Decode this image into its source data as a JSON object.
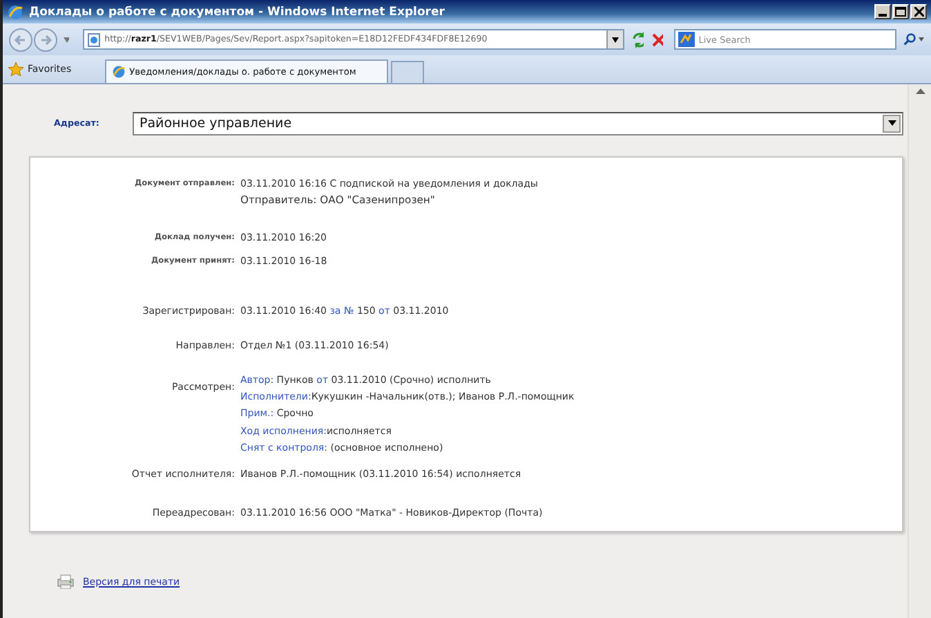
{
  "window": {
    "title": "Доклады о работе с документом - Windows Internet Explorer"
  },
  "toolbar": {
    "address": "http://**razr1**/SEV1WEB/Pages/Sev/Report.aspx?sapitoken=E18D12FEDF434FDF8E12690",
    "search_placeholder": "Live Search"
  },
  "favorites": {
    "label": "Favorites"
  },
  "tabs": [
    {
      "label": "Уведомления/доклады о. работе с документом",
      "selected": true
    }
  ],
  "addressee": {
    "label": "Адресат:",
    "value": "Районное управление"
  },
  "report": [
    {
      "label": "Документ отправлен:",
      "lines": [
        [
          {
            "kind": "text",
            "text": "03.11.2010 16:16 С подпиской на уведомления и доклады"
          }
        ],
        [
          {
            "kind": "text",
            "text": "Отправитель: ОАО \"Сазенипрозен\""
          }
        ]
      ]
    },
    {
      "label": "Доклад получен:",
      "lines": [
        [
          {
            "kind": "text",
            "text": "03.11.2010 16:20"
          }
        ]
      ]
    },
    {
      "label": "Документ принят:",
      "lines": [
        [
          {
            "kind": "text",
            "text": "03.11.2010 16-18"
          }
        ]
      ]
    },
    {
      "label": "Зарегистрирован:",
      "lines": [
        [
          {
            "kind": "text",
            "text": "03.11.2010 16:40 "
          },
          {
            "kind": "link",
            "text": "за №"
          },
          {
            "kind": "text",
            "text": " 150 "
          },
          {
            "kind": "link",
            "text": "от"
          },
          {
            "kind": "text",
            "text": " 03.11.2010"
          }
        ]
      ]
    },
    {
      "label": "Направлен:",
      "lines": [
        [
          {
            "kind": "text",
            "text": "Отдел №1 (03.11.2010 16:54)"
          }
        ]
      ]
    },
    {
      "label": "Рассмотрен:",
      "lines": [
        [
          {
            "kind": "link",
            "text": "Автор:"
          },
          {
            "kind": "text",
            "text": " Пунков "
          },
          {
            "kind": "link",
            "text": "от"
          },
          {
            "kind": "text",
            "text": " 03.11.2010 (Срочно) исполнить"
          }
        ],
        [
          {
            "kind": "link",
            "text": "Исполнители:"
          },
          {
            "kind": "text",
            "text": "Кукушкин -Начальник(отв.); Иванов Р.Л.-помощник"
          }
        ],
        [
          {
            "kind": "link",
            "text": "Прим.:"
          },
          {
            "kind": "text",
            "text": " Срочно"
          }
        ],
        [
          {
            "kind": "link",
            "text": "Ход исполнения:"
          },
          {
            "kind": "text",
            "text": "исполняется"
          }
        ],
        [
          {
            "kind": "link",
            "text": "Снят с контроля:"
          },
          {
            "kind": "text",
            "text": " (основное исполнено)"
          }
        ]
      ]
    },
    {
      "label": "Отчет исполнителя:",
      "lines": [
        [
          {
            "kind": "text",
            "text": "Иванов Р.Л.-помощник (03.11.2010 16:54) исполняется"
          }
        ]
      ]
    },
    {
      "label": "Переадресован:",
      "lines": [
        [
          {
            "kind": "text",
            "text": "03.11.2010 16:56 ООО \"Матка\" - Новиков-Директор (Почта)"
          }
        ]
      ]
    }
  ],
  "print_link": "Версия для печати"
}
